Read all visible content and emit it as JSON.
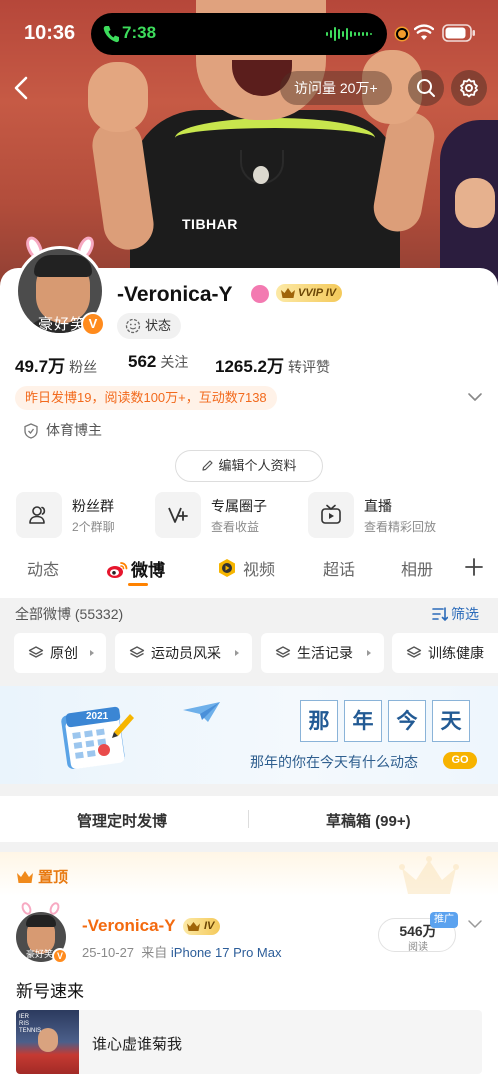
{
  "status_bar": {
    "time": "10:36",
    "call_time": "7:38"
  },
  "header": {
    "visits": "访问量 20万+"
  },
  "profile": {
    "avatar_caption": "豪好笑",
    "verified_badge": "V",
    "name": "-Veronica-Y",
    "vip_level": "VVIP IV",
    "state_label": "状态",
    "stats": [
      {
        "value": "49.7万",
        "label": "粉丝"
      },
      {
        "value": "562",
        "label": "关注"
      },
      {
        "value": "1265.2万",
        "label": "转评赞"
      }
    ],
    "activity": "昨日发博19，阅读数100万+，互动数7138",
    "tag": "体育博主",
    "edit_label": "编辑个人资料"
  },
  "features": [
    {
      "title": "粉丝群",
      "subtitle": "2个群聊",
      "icon": "group-icon"
    },
    {
      "title": "专属圈子",
      "subtitle": "查看收益",
      "icon": "v-plus-icon"
    },
    {
      "title": "直播",
      "subtitle": "查看精彩回放",
      "icon": "tv-icon"
    }
  ],
  "tabs": [
    {
      "label": "动态"
    },
    {
      "label": "微博"
    },
    {
      "label": "视频"
    },
    {
      "label": "超话"
    },
    {
      "label": "相册"
    }
  ],
  "filter": {
    "all_label": "全部微博 (55332)",
    "filter_label": "筛选",
    "chips": [
      {
        "label": "原创"
      },
      {
        "label": "运动员风采"
      },
      {
        "label": "生活记录"
      },
      {
        "label": "训练健康"
      }
    ]
  },
  "banner": {
    "year": "2021",
    "title_chars": [
      "那",
      "年",
      "今",
      "天"
    ],
    "subtitle": "那年的你在今天有什么动态",
    "go": "GO"
  },
  "manage": {
    "scheduled": "管理定时发博",
    "drafts": "草稿箱 (99+)"
  },
  "pinned": {
    "label": "置顶",
    "avatar_caption": "豪好笑",
    "verified_badge": "V",
    "author": "-Veronica-Y",
    "level": "IV",
    "date": "25-10-27",
    "source_prefix": "来自",
    "device": "iPhone 17 Pro Max",
    "reads": "546万",
    "reads_label": "阅读",
    "promo_tag": "推广",
    "text": "新号速来",
    "thumb_text": "IER\nRIS\nTENNIS",
    "link_title": "谁心虚谁菊我"
  },
  "colors": {
    "accent": "#ff8200",
    "link": "#2a6ab9",
    "name_orange": "#f36a0f"
  }
}
